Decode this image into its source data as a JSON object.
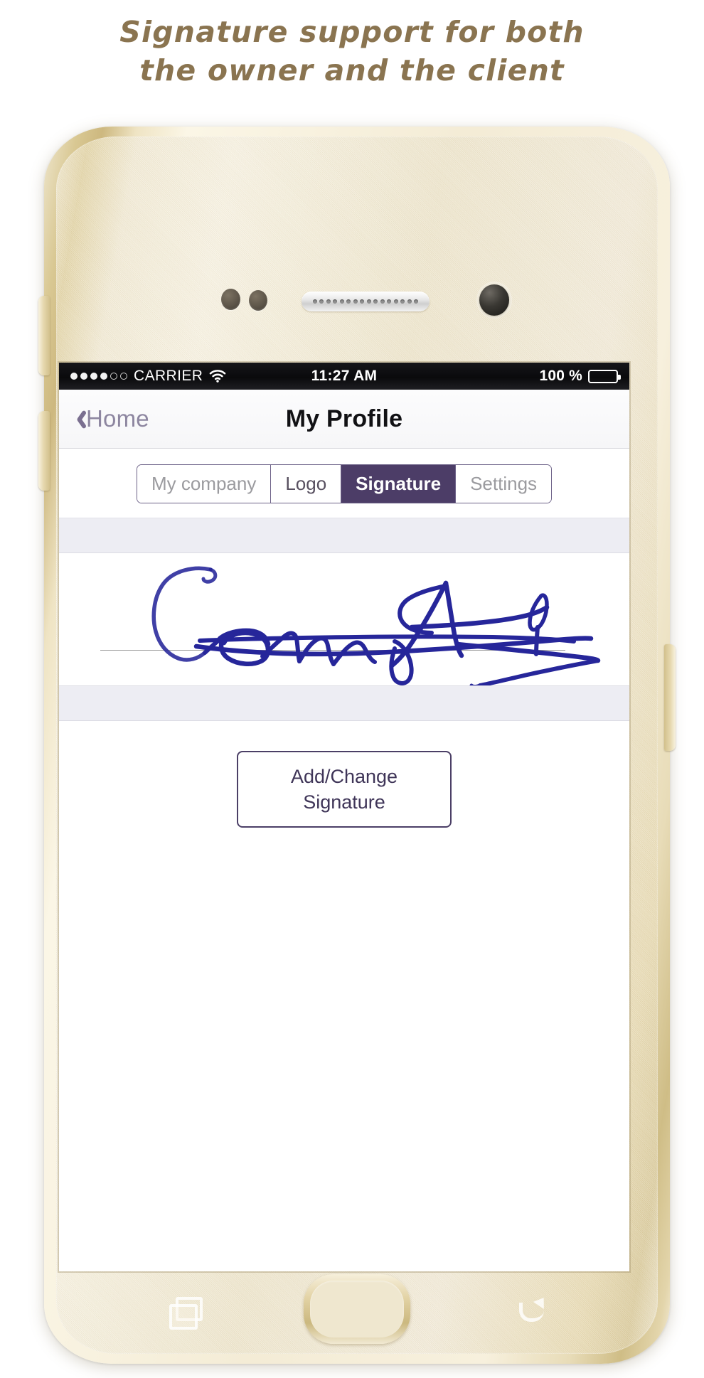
{
  "headline": {
    "line1": "Signature support for both",
    "line2": "the owner and the client",
    "color": "#8a7450"
  },
  "status_bar": {
    "carrier": "CARRIER",
    "signal_dots_filled": 4,
    "signal_dots_empty": 2,
    "wifi_icon": "wifi-icon",
    "time": "11:27 AM",
    "battery_percent": "100 %",
    "battery_icon": "battery-full-icon",
    "background": "#0a0a0c"
  },
  "nav_bar": {
    "back_icon": "chevron-left-icon",
    "back_label": "Home",
    "title": "My Profile",
    "back_color": "#8d86a0",
    "title_color": "#111114"
  },
  "segmented_control": {
    "items": [
      {
        "label": "My company",
        "active": false,
        "muted": true
      },
      {
        "label": "Logo",
        "active": false,
        "muted": false
      },
      {
        "label": "Signature",
        "active": true,
        "muted": false
      },
      {
        "label": "Settings",
        "active": false,
        "muted": true
      }
    ],
    "active_background": "#4c3d67",
    "border_color": "#6d6288"
  },
  "signature_panel": {
    "band_color": "#ededf3",
    "canvas_background": "#ffffff",
    "ink_color": "#26269a",
    "baseline_color": "#9a9a9a",
    "description": "handwritten signature stroke"
  },
  "action_button": {
    "line1": "Add/Change",
    "line2": "Signature",
    "border_color": "#4b3f66",
    "text_color": "#3f3558"
  },
  "device": {
    "body_color": "#efe7cf",
    "frame_color": "#cdb87f",
    "hardware": {
      "sensor_1": "proximity-sensor",
      "sensor_2": "light-sensor",
      "speaker": "earpiece-speaker",
      "front_camera": "front-camera",
      "volume_up": "volume-up-button",
      "volume_down": "volume-down-button",
      "power": "power-button"
    },
    "soft_keys": {
      "recents": "recents-icon",
      "home": "home-button",
      "back": "back-arrow-icon"
    }
  }
}
